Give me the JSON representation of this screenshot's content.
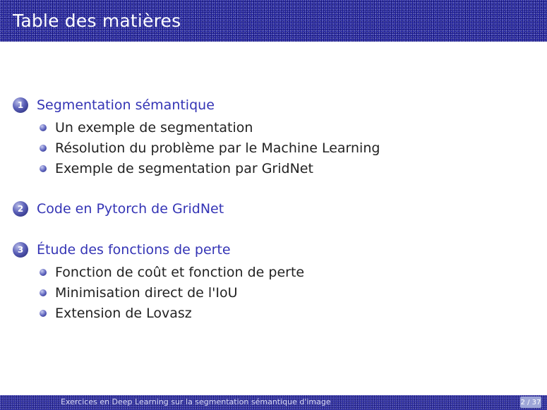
{
  "header": {
    "title": "Table des matières"
  },
  "sections": [
    {
      "number": "1",
      "title": "Segmentation sémantique",
      "items": [
        "Un exemple de segmentation",
        "Résolution du problème par le Machine Learning",
        "Exemple de segmentation par GridNet"
      ]
    },
    {
      "number": "2",
      "title": "Code en Pytorch de GridNet",
      "items": []
    },
    {
      "number": "3",
      "title": "Étude des fonctions de perte",
      "items": [
        "Fonction de coût et fonction de perte",
        "Minimisation direct de l'IoU",
        "Extension de Lovasz"
      ]
    }
  ],
  "footer": {
    "text": "Exercices en Deep Learning sur la segmentation sémantique d'image",
    "page": "2 / 37"
  },
  "colors": {
    "header_bg": "#1f1f9a",
    "section_title": "#3434b5",
    "item_text": "#222222"
  }
}
